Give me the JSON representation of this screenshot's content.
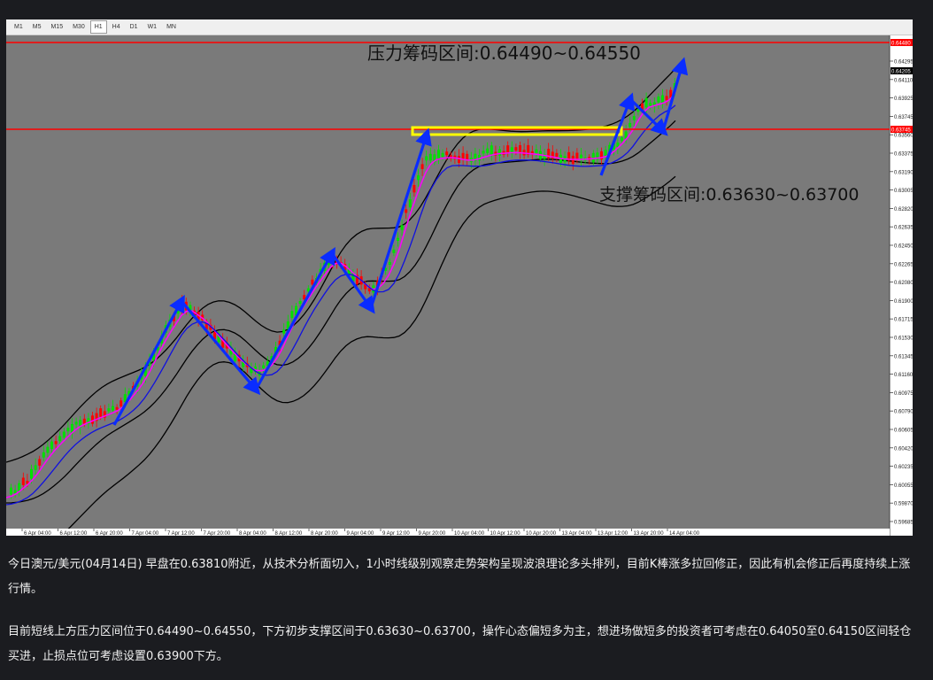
{
  "toolbar": {
    "timeframes": [
      "M1",
      "M5",
      "M15",
      "M30",
      "H1",
      "H4",
      "D1",
      "W1",
      "MN"
    ],
    "active": "H1"
  },
  "chart": {
    "annotations": {
      "resistance": "压力筹码区间:0.64490~0.64550",
      "support": "支撑筹码区间:0.63630~0.63700"
    },
    "price_axis": [
      "0.64295",
      "0.64110",
      "0.63925",
      "0.63745",
      "0.63560",
      "0.63375",
      "0.63190",
      "0.63005",
      "0.62820",
      "0.62635",
      "0.62450",
      "0.62265",
      "0.62080",
      "0.61900",
      "0.61715",
      "0.61530",
      "0.61345",
      "0.61160",
      "0.60975",
      "0.60790",
      "0.60605",
      "0.60420",
      "0.60235",
      "0.60055",
      "0.59870",
      "0.59685"
    ],
    "time_axis": [
      "6 Apr 04:00",
      "6 Apr 12:00",
      "6 Apr 20:00",
      "7 Apr 04:00",
      "7 Apr 12:00",
      "7 Apr 20:00",
      "8 Apr 04:00",
      "8 Apr 12:00",
      "8 Apr 20:00",
      "9 Apr 04:00",
      "9 Apr 12:00",
      "9 Apr 20:00",
      "10 Apr 04:00",
      "10 Apr 12:00",
      "10 Apr 20:00",
      "13 Apr 04:00",
      "13 Apr 12:00",
      "13 Apr 20:00",
      "14 Apr 04:00"
    ],
    "price_tags": {
      "top": "0.64480",
      "current": "0.64205",
      "level": "0.63745"
    },
    "colors": {
      "background": "#7a7a7a",
      "bull_candle": "#00e000",
      "bear_candle": "#ff0000",
      "bands": "#000000",
      "ma_fast": "#ff00ff",
      "ma_slow": "#1010e0",
      "wave_arrows": "#0a2cff",
      "resistance_line": "#ff0000",
      "consolidation_box": "#ffff00"
    }
  },
  "article": {
    "paragraph_1": "今日澳元/美元(04月14日) 早盘在0.63810附近，从技术分析面切入，1小时线级别观察走势架构呈现波浪理论多头排列，目前K棒涨多拉回修正，因此有机会修正后再度持续上涨行情。",
    "paragraph_2": "目前短线上方压力区间位于0.64490~0.64550，下方初步支撑区间于0.63630~0.63700，操作心态偏短多为主，想进场做短多的投资者可考虑在0.64050至0.64150区间轻仓买进，止损点位可考虑设置0.63900下方。"
  }
}
